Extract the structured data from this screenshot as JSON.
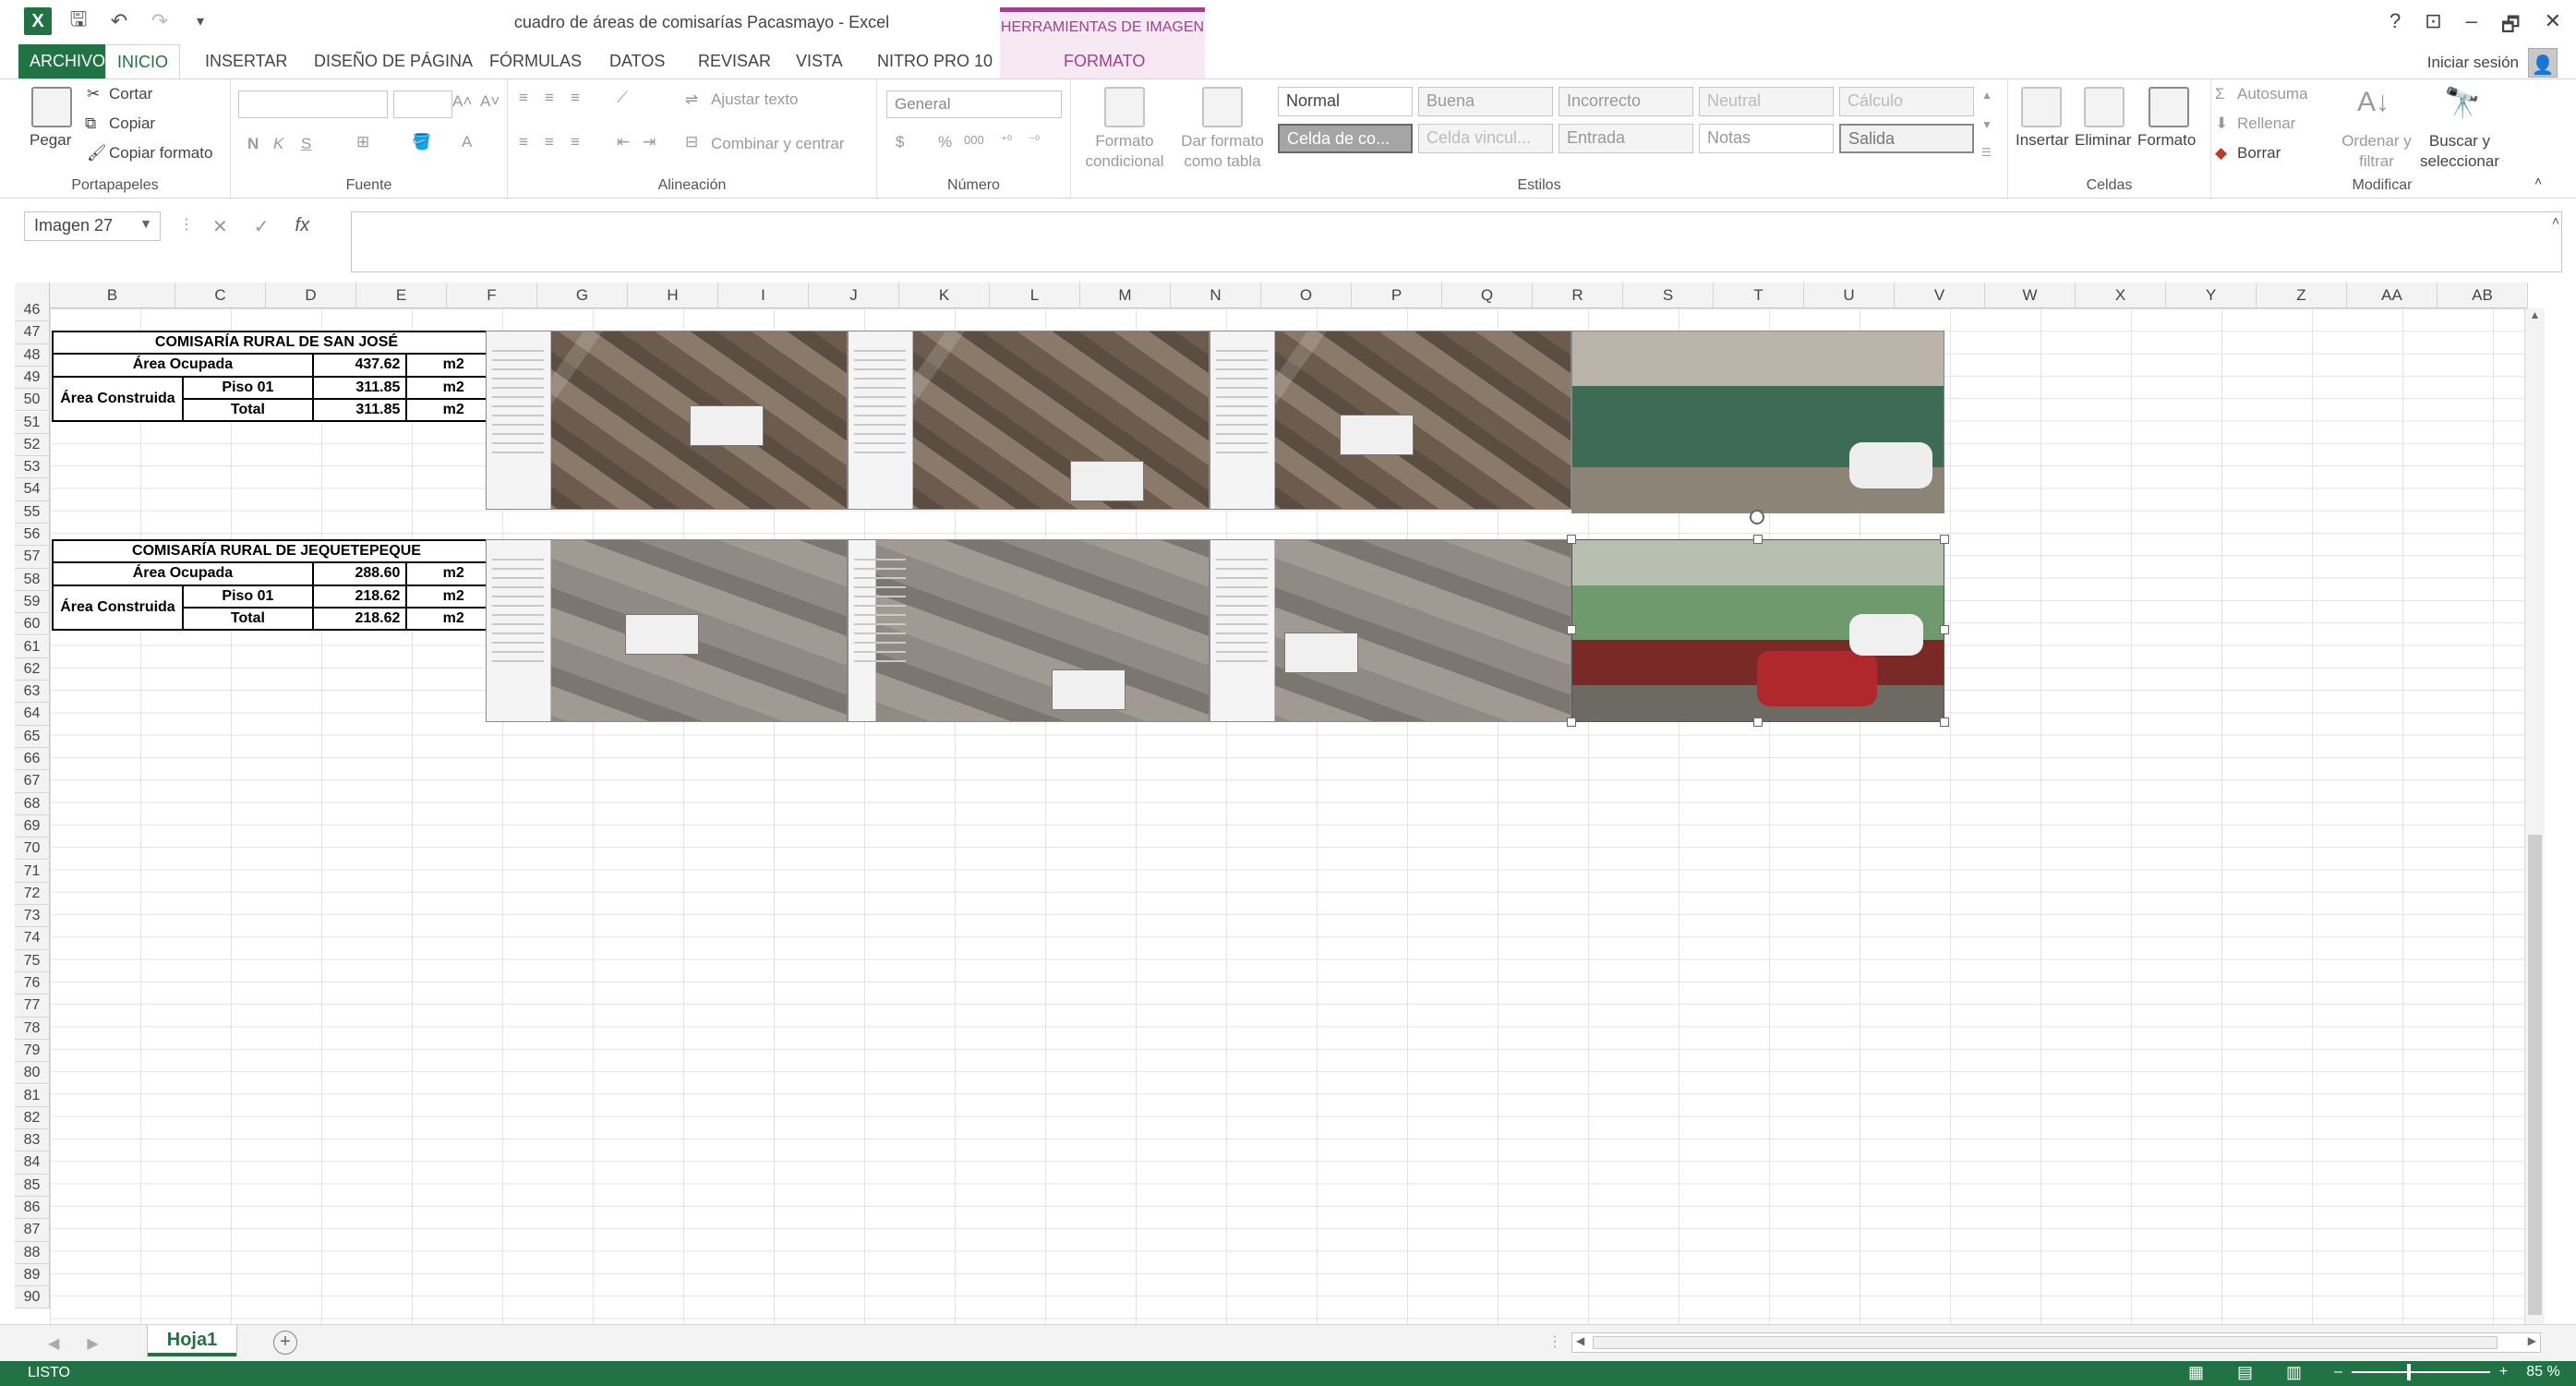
{
  "titlebar": {
    "doc_title": "cuadro de áreas de comisarías Pacasmayo - Excel",
    "contextual_header": "HERRAMIENTAS DE IMAGEN",
    "help": "?",
    "minimize": "–",
    "restore": "🗗",
    "close": "✕"
  },
  "tabs": {
    "file": "ARCHIVO",
    "home": "INICIO",
    "insert": "INSERTAR",
    "page_layout": "DISEÑO DE PÁGINA",
    "formulas": "FÓRMULAS",
    "data": "DATOS",
    "review": "REVISAR",
    "view": "VISTA",
    "nitro": "NITRO PRO 10",
    "format": "FORMATO",
    "signin": "Iniciar sesión"
  },
  "ribbon": {
    "clipboard": {
      "label": "Portapapeles",
      "paste": "Pegar",
      "cut": "Cortar",
      "copy": "Copiar",
      "format_painter": "Copiar formato"
    },
    "font": {
      "label": "Fuente",
      "bold": "N",
      "italic": "K",
      "underline": "S"
    },
    "alignment": {
      "label": "Alineación",
      "wrap": "Ajustar texto",
      "merge": "Combinar y centrar"
    },
    "number": {
      "label": "Número",
      "format": "General",
      "currency": "$",
      "percent": "%",
      "thousands": "000"
    },
    "styles": {
      "label": "Estilos",
      "conditional": "Formato condicional",
      "as_table": "Dar formato como tabla",
      "cells": [
        "Normal",
        "Buena",
        "Incorrecto",
        "Neutral",
        "Cálculo",
        "Celda de co...",
        "Celda vincul...",
        "Entrada",
        "Notas",
        "Salida"
      ]
    },
    "cells": {
      "label": "Celdas",
      "insert": "Insertar",
      "delete": "Eliminar",
      "format": "Formato"
    },
    "editing": {
      "label": "Modificar",
      "autosum": "Autosuma",
      "fill": "Rellenar",
      "clear": "Borrar",
      "sort": "Ordenar y filtrar",
      "find": "Buscar y seleccionar"
    }
  },
  "formula_bar": {
    "name_box": "Imagen 27",
    "fx": "fx",
    "value": ""
  },
  "columns": [
    "B",
    "C",
    "D",
    "E",
    "F",
    "G",
    "H",
    "I",
    "J",
    "K",
    "L",
    "M",
    "N",
    "O",
    "P",
    "Q",
    "R",
    "S",
    "T",
    "U",
    "V",
    "W",
    "X",
    "Y",
    "Z",
    "AA",
    "AB"
  ],
  "rows": [
    "46",
    "47",
    "48",
    "49",
    "50",
    "51",
    "52",
    "53",
    "54",
    "55",
    "56",
    "57",
    "58",
    "59",
    "60",
    "61",
    "62",
    "63",
    "64",
    "65",
    "66",
    "67",
    "68",
    "69",
    "70",
    "71",
    "72",
    "73",
    "74",
    "75",
    "76",
    "77",
    "78",
    "79",
    "80",
    "81",
    "82",
    "83",
    "84",
    "85",
    "86",
    "87",
    "88",
    "89",
    "90"
  ],
  "tables": [
    {
      "title": "COMISARÍA RURAL DE SAN JOSÉ",
      "area_ocupada_label": "Área Ocupada",
      "area_ocupada": "437.62",
      "area_construida_label": "Área Construida",
      "piso_label": "Piso 01",
      "piso": "311.85",
      "total_label": "Total",
      "total": "311.85",
      "unit": "m2"
    },
    {
      "title": "COMISARÍA RURAL DE JEQUETEPEQUE",
      "area_ocupada_label": "Área Ocupada",
      "area_ocupada": "288.60",
      "area_construida_label": "Área Construida",
      "piso_label": "Piso 01",
      "piso": "218.62",
      "total_label": "Total",
      "total": "218.62",
      "unit": "m2"
    }
  ],
  "sheet": {
    "tab": "Hoja1",
    "add": "+"
  },
  "status": {
    "ready": "LISTO",
    "zoom": "85 %",
    "zoom_fraction": 0.85
  },
  "colors": {
    "excel_green": "#217346",
    "image_tools": "#a33f8e"
  }
}
